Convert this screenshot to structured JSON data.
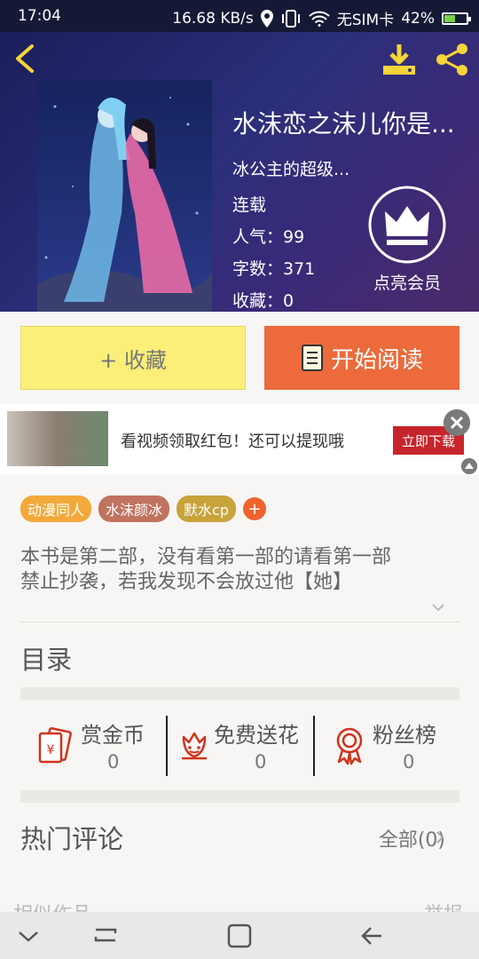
{
  "status_bar": {
    "time": "17:04",
    "network_speed": "16.68 KB/s",
    "sim": "无SIM卡",
    "battery": "42%",
    "icons": [
      "location-icon",
      "vibrate-icon",
      "wifi-icon",
      "battery-icon"
    ]
  },
  "book": {
    "title": "水沫恋之沫儿你是...",
    "author": "冰公主的超级...",
    "status": "连载",
    "popularity": "人气：99",
    "word_count": "字数：371",
    "favorites": "收藏：0"
  },
  "vip": {
    "label": "点亮会员"
  },
  "actions": {
    "favorite": "+ 收藏",
    "read": "开始阅读"
  },
  "ad": {
    "text": "看视频领取红包！还可以提现哦",
    "button": "立即下载"
  },
  "tags": [
    {
      "label": "动漫同人",
      "color": "#f3a93a"
    },
    {
      "label": "水沫颜冰",
      "color": "#c0735e"
    },
    {
      "label": "默水cp",
      "color": "#c8a33a"
    }
  ],
  "tag_add": "+",
  "description": {
    "line1": "本书是第二部，没有看第一部的请看第一部",
    "line2": "禁止抄袭，若我发现不会放过他【她】"
  },
  "toc": {
    "label": "目录"
  },
  "stats": [
    {
      "label": "赏金币",
      "value": "0",
      "icon": "red-envelope-icon"
    },
    {
      "label": "免费送花",
      "value": "0",
      "icon": "flower-icon"
    },
    {
      "label": "粉丝榜",
      "value": "0",
      "icon": "medal-icon"
    }
  ],
  "comments": {
    "title": "热门评论",
    "all": "全部(0)"
  },
  "similar": {
    "title": "相似作品",
    "report": "举报"
  },
  "colors": {
    "accent_orange": "#ec6a3b",
    "fav_yellow": "#fbef7a",
    "icon_yellow": "#f5d53a",
    "stat_red": "#d0331c"
  }
}
